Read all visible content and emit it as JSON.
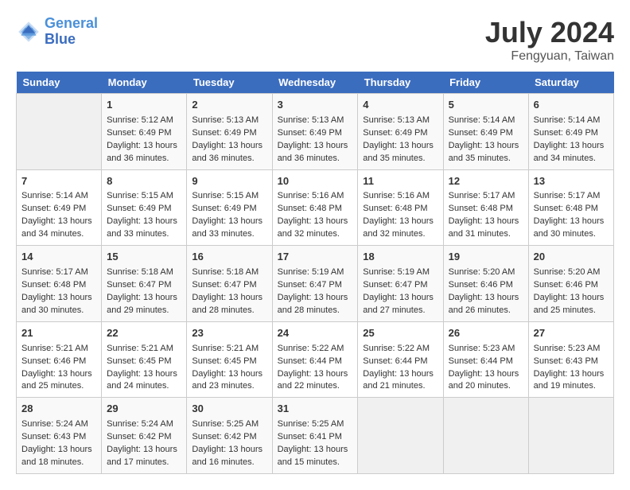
{
  "header": {
    "logo_line1": "General",
    "logo_line2": "Blue",
    "month": "July 2024",
    "location": "Fengyuan, Taiwan"
  },
  "weekdays": [
    "Sunday",
    "Monday",
    "Tuesday",
    "Wednesday",
    "Thursday",
    "Friday",
    "Saturday"
  ],
  "weeks": [
    [
      {
        "day": "",
        "info": ""
      },
      {
        "day": "1",
        "info": "Sunrise: 5:12 AM\nSunset: 6:49 PM\nDaylight: 13 hours\nand 36 minutes."
      },
      {
        "day": "2",
        "info": "Sunrise: 5:13 AM\nSunset: 6:49 PM\nDaylight: 13 hours\nand 36 minutes."
      },
      {
        "day": "3",
        "info": "Sunrise: 5:13 AM\nSunset: 6:49 PM\nDaylight: 13 hours\nand 36 minutes."
      },
      {
        "day": "4",
        "info": "Sunrise: 5:13 AM\nSunset: 6:49 PM\nDaylight: 13 hours\nand 35 minutes."
      },
      {
        "day": "5",
        "info": "Sunrise: 5:14 AM\nSunset: 6:49 PM\nDaylight: 13 hours\nand 35 minutes."
      },
      {
        "day": "6",
        "info": "Sunrise: 5:14 AM\nSunset: 6:49 PM\nDaylight: 13 hours\nand 34 minutes."
      }
    ],
    [
      {
        "day": "7",
        "info": "Sunrise: 5:14 AM\nSunset: 6:49 PM\nDaylight: 13 hours\nand 34 minutes."
      },
      {
        "day": "8",
        "info": "Sunrise: 5:15 AM\nSunset: 6:49 PM\nDaylight: 13 hours\nand 33 minutes."
      },
      {
        "day": "9",
        "info": "Sunrise: 5:15 AM\nSunset: 6:49 PM\nDaylight: 13 hours\nand 33 minutes."
      },
      {
        "day": "10",
        "info": "Sunrise: 5:16 AM\nSunset: 6:48 PM\nDaylight: 13 hours\nand 32 minutes."
      },
      {
        "day": "11",
        "info": "Sunrise: 5:16 AM\nSunset: 6:48 PM\nDaylight: 13 hours\nand 32 minutes."
      },
      {
        "day": "12",
        "info": "Sunrise: 5:17 AM\nSunset: 6:48 PM\nDaylight: 13 hours\nand 31 minutes."
      },
      {
        "day": "13",
        "info": "Sunrise: 5:17 AM\nSunset: 6:48 PM\nDaylight: 13 hours\nand 30 minutes."
      }
    ],
    [
      {
        "day": "14",
        "info": "Sunrise: 5:17 AM\nSunset: 6:48 PM\nDaylight: 13 hours\nand 30 minutes."
      },
      {
        "day": "15",
        "info": "Sunrise: 5:18 AM\nSunset: 6:47 PM\nDaylight: 13 hours\nand 29 minutes."
      },
      {
        "day": "16",
        "info": "Sunrise: 5:18 AM\nSunset: 6:47 PM\nDaylight: 13 hours\nand 28 minutes."
      },
      {
        "day": "17",
        "info": "Sunrise: 5:19 AM\nSunset: 6:47 PM\nDaylight: 13 hours\nand 28 minutes."
      },
      {
        "day": "18",
        "info": "Sunrise: 5:19 AM\nSunset: 6:47 PM\nDaylight: 13 hours\nand 27 minutes."
      },
      {
        "day": "19",
        "info": "Sunrise: 5:20 AM\nSunset: 6:46 PM\nDaylight: 13 hours\nand 26 minutes."
      },
      {
        "day": "20",
        "info": "Sunrise: 5:20 AM\nSunset: 6:46 PM\nDaylight: 13 hours\nand 25 minutes."
      }
    ],
    [
      {
        "day": "21",
        "info": "Sunrise: 5:21 AM\nSunset: 6:46 PM\nDaylight: 13 hours\nand 25 minutes."
      },
      {
        "day": "22",
        "info": "Sunrise: 5:21 AM\nSunset: 6:45 PM\nDaylight: 13 hours\nand 24 minutes."
      },
      {
        "day": "23",
        "info": "Sunrise: 5:21 AM\nSunset: 6:45 PM\nDaylight: 13 hours\nand 23 minutes."
      },
      {
        "day": "24",
        "info": "Sunrise: 5:22 AM\nSunset: 6:44 PM\nDaylight: 13 hours\nand 22 minutes."
      },
      {
        "day": "25",
        "info": "Sunrise: 5:22 AM\nSunset: 6:44 PM\nDaylight: 13 hours\nand 21 minutes."
      },
      {
        "day": "26",
        "info": "Sunrise: 5:23 AM\nSunset: 6:44 PM\nDaylight: 13 hours\nand 20 minutes."
      },
      {
        "day": "27",
        "info": "Sunrise: 5:23 AM\nSunset: 6:43 PM\nDaylight: 13 hours\nand 19 minutes."
      }
    ],
    [
      {
        "day": "28",
        "info": "Sunrise: 5:24 AM\nSunset: 6:43 PM\nDaylight: 13 hours\nand 18 minutes."
      },
      {
        "day": "29",
        "info": "Sunrise: 5:24 AM\nSunset: 6:42 PM\nDaylight: 13 hours\nand 17 minutes."
      },
      {
        "day": "30",
        "info": "Sunrise: 5:25 AM\nSunset: 6:42 PM\nDaylight: 13 hours\nand 16 minutes."
      },
      {
        "day": "31",
        "info": "Sunrise: 5:25 AM\nSunset: 6:41 PM\nDaylight: 13 hours\nand 15 minutes."
      },
      {
        "day": "",
        "info": ""
      },
      {
        "day": "",
        "info": ""
      },
      {
        "day": "",
        "info": ""
      }
    ]
  ]
}
